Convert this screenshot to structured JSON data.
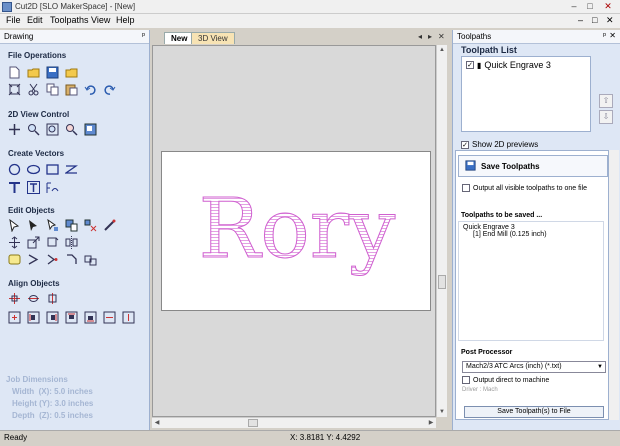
{
  "window": {
    "title": "Cut2D [SLO MakerSpace] - [New]",
    "minimize": "–",
    "maximize": "□",
    "close": "✕"
  },
  "menu": {
    "items": [
      "File",
      "Edit",
      "Toolpaths",
      "View",
      "Help"
    ],
    "right_min": "–",
    "right_max": "□",
    "right_close": "✕"
  },
  "left_panel": {
    "header": "Drawing",
    "pin": "ᵖ",
    "sections": {
      "file_operations": "File Operations",
      "view_control": "2D View Control",
      "create_vectors": "Create Vectors",
      "edit_objects": "Edit Objects",
      "align_objects": "Align Objects"
    },
    "job_dimensions": {
      "title": "Job Dimensions",
      "width": "Width  (X): 5.0 inches",
      "height": "Height (Y): 3.0 inches",
      "depth": "Depth  (Z): 0.5 inches"
    }
  },
  "center": {
    "tabs": [
      "New",
      "3D View"
    ],
    "tab_controls": {
      "prev": "◂",
      "next": "▸",
      "close": "✕"
    },
    "design_text": "Rory",
    "colors": {
      "design": "#d060d0",
      "sheet": "#ffffff",
      "background": "#d9d9d9"
    }
  },
  "right_panel": {
    "header": "Toolpaths",
    "pin": "ᵖ",
    "close": "✕",
    "list_title": "Toolpath List",
    "toolpaths": [
      {
        "name": "Quick Engrave 3",
        "checked": true
      }
    ],
    "show_2d_previews": "Show 2D previews",
    "save_panel": {
      "title": "Save Toolpaths",
      "output_all": "Output all visible toolpaths to one file",
      "to_be_saved": "Toolpaths to be saved ...",
      "saved_name": "Quick Engrave 3",
      "saved_tool": "[1] End Mill (0.125 inch)",
      "post_processor_label": "Post Processor",
      "post_processor_value": "Mach2/3 ATC Arcs (inch) (*.txt)",
      "output_direct": "Output direct to machine",
      "driver": "Driver : Mach",
      "save_button": "Save Toolpath(s) to File"
    }
  },
  "status": {
    "ready": "Ready",
    "coords": "X: 3.8181 Y: 4.4292"
  }
}
